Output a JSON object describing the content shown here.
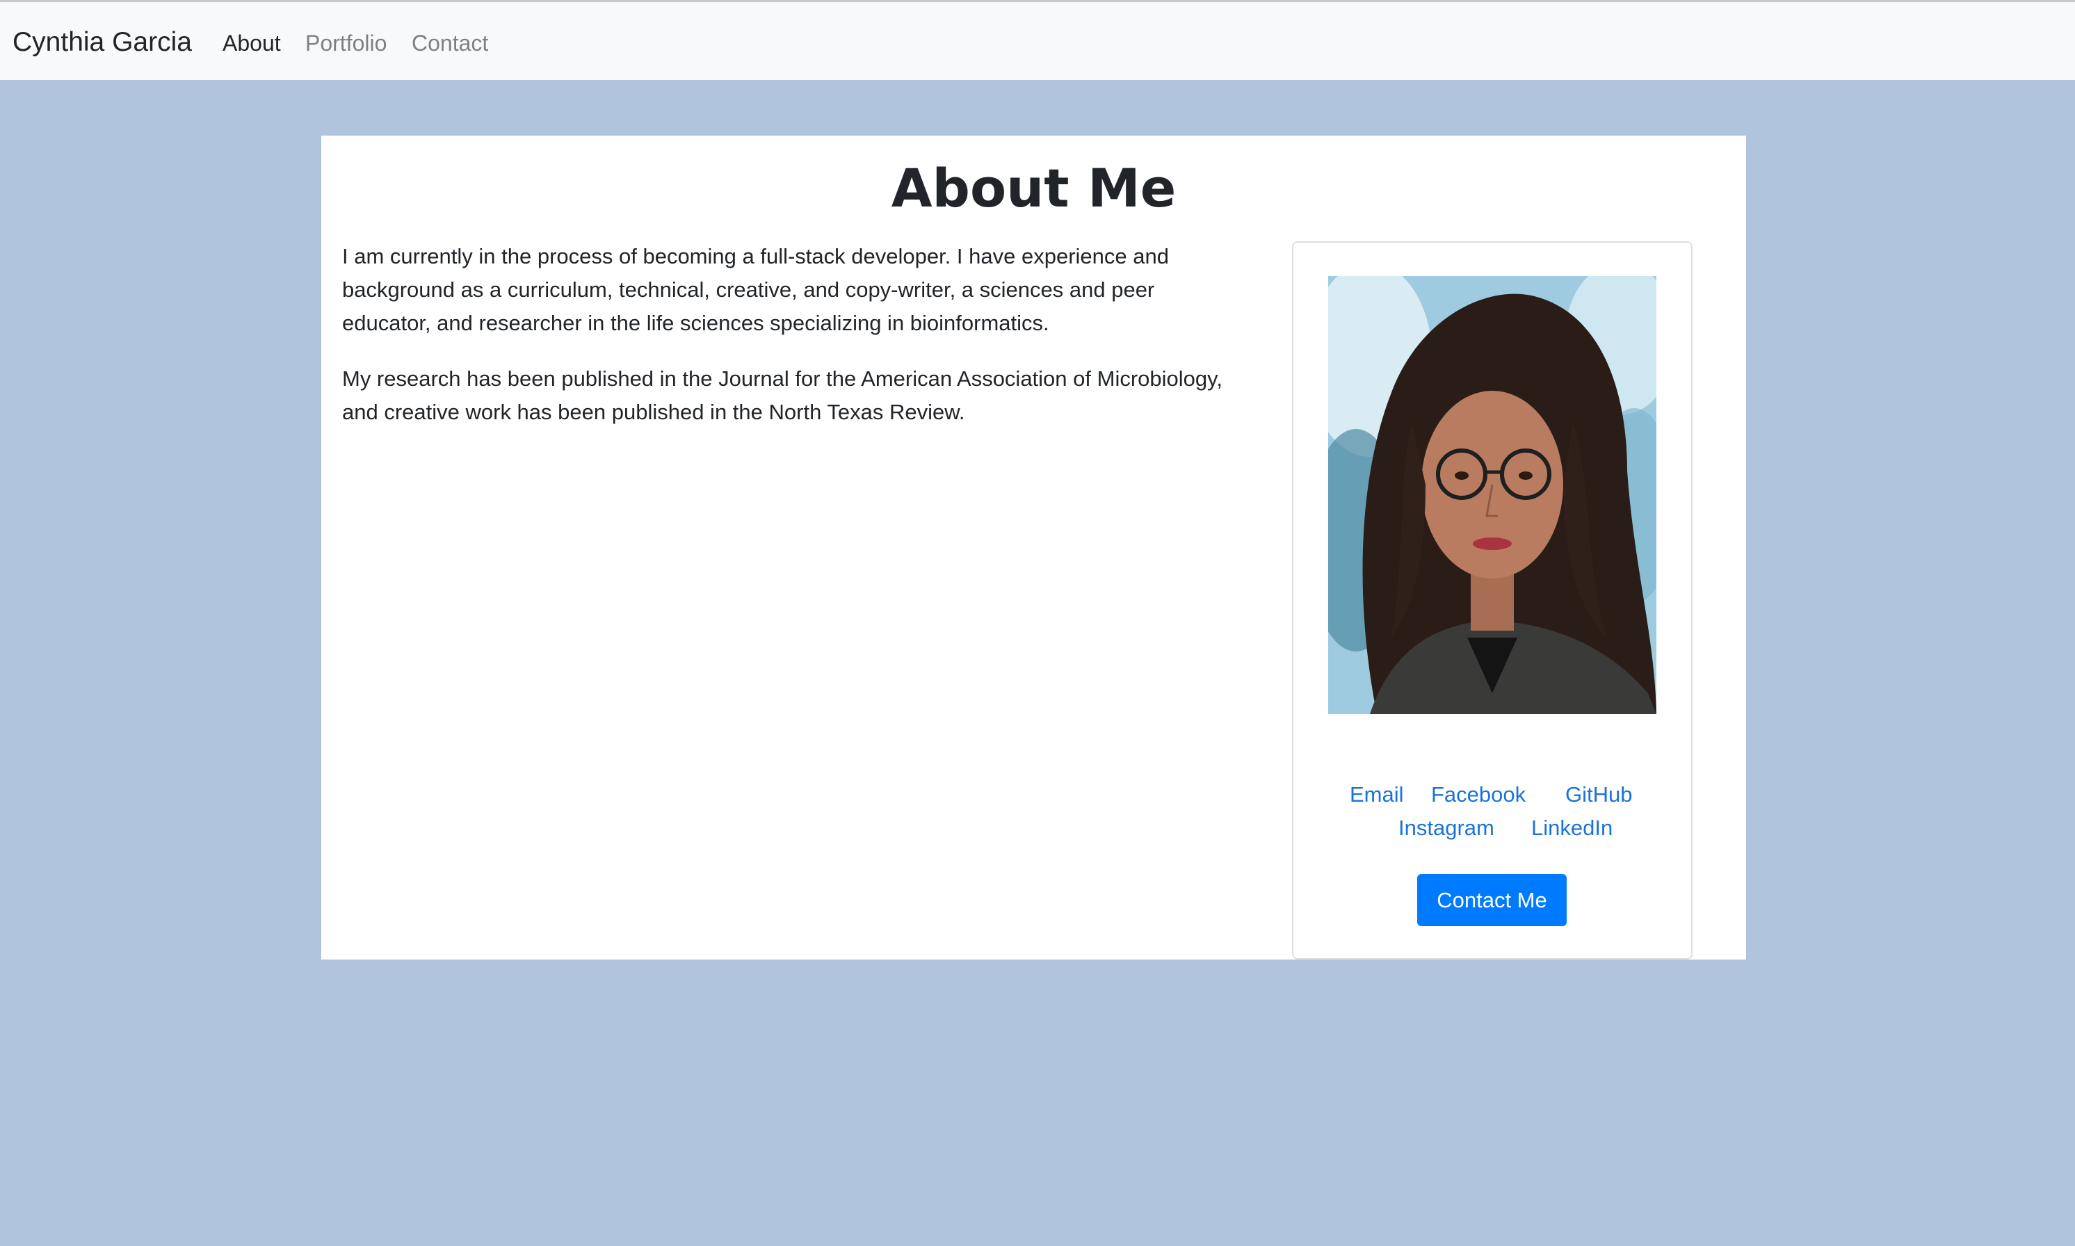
{
  "nav": {
    "brand": "Cynthia Garcia",
    "links": [
      {
        "label": "About",
        "active": true
      },
      {
        "label": "Portfolio",
        "active": false
      },
      {
        "label": "Contact",
        "active": false
      }
    ]
  },
  "main": {
    "title": "About Me",
    "paragraphs": [
      "I am currently in the process of becoming a full-stack developer. I have experience and background as a curriculum, technical, creative, and copy-writer, a sciences and peer educator, and researcher in the life sciences specializing in bioinformatics.",
      "My research has been published in the Journal for the American Association of Microbiology, and creative work has been published in the North Texas Review."
    ]
  },
  "card": {
    "links": [
      "Email",
      "Facebook",
      "GitHub",
      "Instagram",
      "LinkedIn"
    ],
    "button_label": "Contact Me"
  },
  "colors": {
    "page_background": "#b0c4de",
    "navbar_background": "#f8f9fa",
    "link": "#1a73d9",
    "button": "#007bff",
    "text": "#212529"
  }
}
